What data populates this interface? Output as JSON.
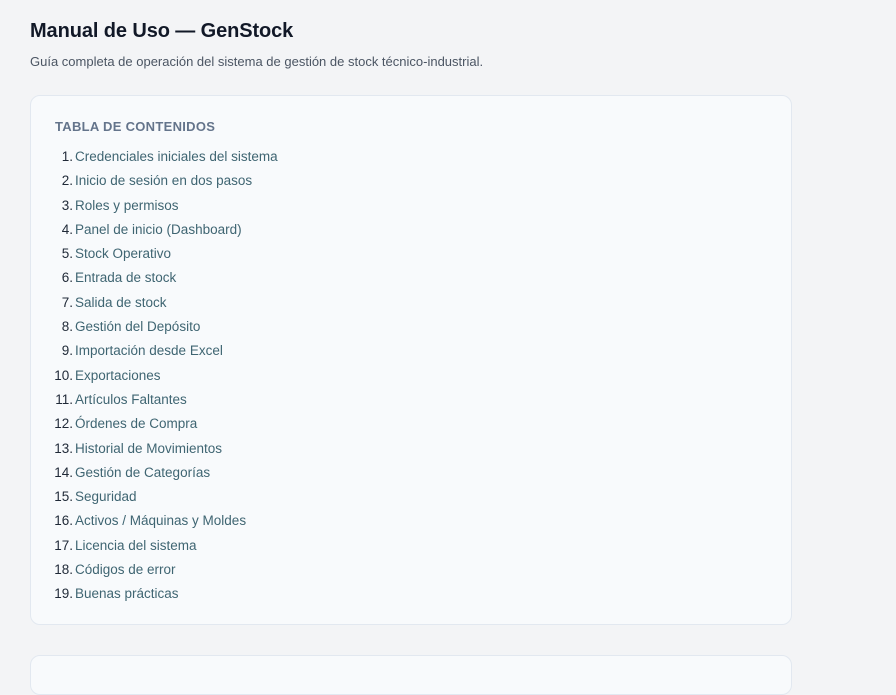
{
  "header": {
    "title": "Manual de Uso — GenStock",
    "subtitle": "Guía completa de operación del sistema de gestión de stock técnico-industrial."
  },
  "toc": {
    "heading": "TABLA DE CONTENIDOS",
    "items": [
      {
        "num": "1.",
        "label": "Credenciales iniciales del sistema"
      },
      {
        "num": "2.",
        "label": "Inicio de sesión en dos pasos"
      },
      {
        "num": "3.",
        "label": "Roles y permisos"
      },
      {
        "num": "4.",
        "label": "Panel de inicio (Dashboard)"
      },
      {
        "num": "5.",
        "label": "Stock Operativo"
      },
      {
        "num": "6.",
        "label": "Entrada de stock"
      },
      {
        "num": "7.",
        "label": "Salida de stock"
      },
      {
        "num": "8.",
        "label": "Gestión del Depósito"
      },
      {
        "num": "9.",
        "label": "Importación desde Excel"
      },
      {
        "num": "10.",
        "label": "Exportaciones"
      },
      {
        "num": "11.",
        "label": "Artículos Faltantes"
      },
      {
        "num": "12.",
        "label": "Órdenes de Compra"
      },
      {
        "num": "13.",
        "label": "Historial de Movimientos"
      },
      {
        "num": "14.",
        "label": "Gestión de Categorías"
      },
      {
        "num": "15.",
        "label": "Seguridad"
      },
      {
        "num": "16.",
        "label": "Activos / Máquinas y Moldes"
      },
      {
        "num": "17.",
        "label": "Licencia del sistema"
      },
      {
        "num": "18.",
        "label": "Códigos de error"
      },
      {
        "num": "19.",
        "label": "Buenas prácticas"
      }
    ]
  }
}
